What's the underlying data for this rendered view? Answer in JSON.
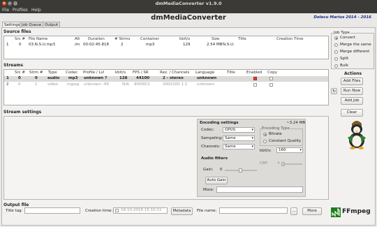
{
  "window_title": "dmMediaConverter v1.9.0",
  "menu": [
    "File",
    "Profiles",
    "Help"
  ],
  "app_title": "dmMediaConverter",
  "author": "Delecu Marius 2014 - 2016",
  "tabs": [
    "Settings",
    "Job Queue",
    "Output"
  ],
  "source": {
    "heading": "Source files",
    "columns": [
      "Src #",
      "File Name",
      "Alt",
      "Duration",
      "# Strms",
      "Container",
      "kbit/s",
      "Size",
      "Title",
      "Creation Time"
    ],
    "rows": [
      [
        "1",
        "0",
        "03.N.S.U.mp3",
        "/m",
        "00:02:45.818",
        "2",
        "mp3",
        "129",
        "2.54 MB",
        "N.S.U."
      ]
    ]
  },
  "job_type": {
    "heading": "Job Type",
    "options": [
      "Convert",
      "Merge the same",
      "Merge different",
      "Split",
      "Bulk"
    ],
    "selected": "Convert"
  },
  "actions": {
    "heading": "Actions",
    "add_files": "Add Files",
    "run_now": "Run Now",
    "add_job": "Add Job",
    "clear": "Clear"
  },
  "streams": {
    "heading": "Streams",
    "columns": [
      "Src #",
      "Strm #",
      "Type",
      "Codec",
      "Profile / Lvl",
      "kbit/s",
      "FPS / SR",
      "Rez. / Channels",
      "Language",
      "Title",
      "Enabled",
      "Copy"
    ],
    "rows": [
      [
        "1",
        "0",
        "0",
        "audio",
        "mp3",
        "unknown ?",
        "128",
        "44100",
        "2 - stereo",
        "unknown"
      ],
      [
        "2",
        "0",
        "1",
        "video",
        "mjpeg",
        "unknown -99",
        "N/A",
        "90000/1",
        "200X200 1:1",
        "unknown"
      ]
    ]
  },
  "stream_settings": {
    "heading": "Stream settings",
    "encoding_heading": "Encoding settings",
    "size_estimate": "~3.24 MB",
    "codec_label": "Codec:",
    "codec_value": "OPUS",
    "sampling_label": "Sampeling:",
    "sampling_value": "Same",
    "channels_label": "Channels:",
    "channels_value": "Same",
    "encoding_type_heading": "Encoding Type",
    "bitrate_label": "Bitrate",
    "constant_quality_label": "Constant Quality",
    "kbits_label": "kbit/s:",
    "kbits_value": "160",
    "crf_label": "CRF:",
    "crf_value": "4",
    "audio_filters_heading": "Audio filters",
    "gain_label": "Gain:",
    "gain_value": "0",
    "auto_gain": "Auto Gain",
    "more_label": "More:"
  },
  "output": {
    "heading": "Output file",
    "title_tag_label": "Title tag:",
    "creation_time_label": "Creation time:",
    "creation_time_value": "18-10-2016    15:10:11",
    "metadata_button": "Metadata",
    "file_name_label": "File name:",
    "dots_button": "...",
    "more_button": "More",
    "ffmpeg_logo": "FFmpeg"
  },
  "colors": {
    "titlebar": "#3b3a36",
    "close": "#df4a16",
    "accent": "#d0342c",
    "author": "#1a2e8c",
    "ffmpeg_green": "#1b7f1b"
  }
}
